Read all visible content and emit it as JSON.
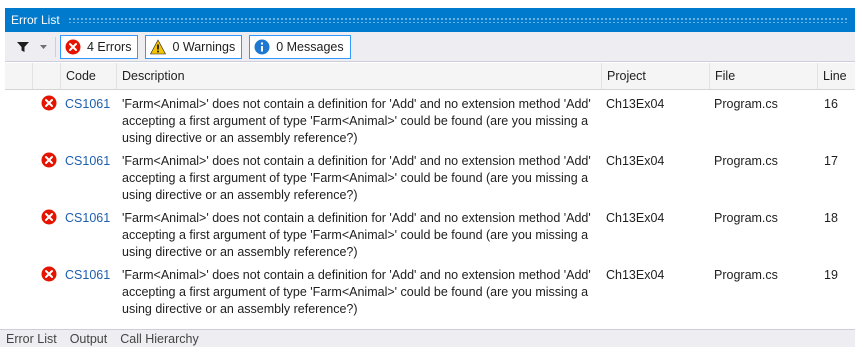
{
  "window": {
    "title": "Error List"
  },
  "toolbar": {
    "errors_label": "4 Errors",
    "warnings_label": "0 Warnings",
    "messages_label": "0 Messages"
  },
  "columns": {
    "code": "Code",
    "description": "Description",
    "project": "Project",
    "file": "File",
    "line": "Line"
  },
  "errors": [
    {
      "code": "CS1061",
      "description": "'Farm<Animal>' does not contain a definition for 'Add' and no extension method 'Add' accepting a first argument of type 'Farm<Animal>' could be found (are you missing a using directive or an assembly reference?)",
      "project": "Ch13Ex04",
      "file": "Program.cs",
      "line": "16"
    },
    {
      "code": "CS1061",
      "description": "'Farm<Animal>' does not contain a definition for 'Add' and no extension method 'Add' accepting a first argument of type 'Farm<Animal>' could be found (are you missing a using directive or an assembly reference?)",
      "project": "Ch13Ex04",
      "file": "Program.cs",
      "line": "17"
    },
    {
      "code": "CS1061",
      "description": "'Farm<Animal>' does not contain a definition for 'Add' and no extension method 'Add' accepting a first argument of type 'Farm<Animal>' could be found (are you missing a using directive or an assembly reference?)",
      "project": "Ch13Ex04",
      "file": "Program.cs",
      "line": "18"
    },
    {
      "code": "CS1061",
      "description": "'Farm<Animal>' does not contain a definition for 'Add' and no extension method 'Add' accepting a first argument of type 'Farm<Animal>' could be found (are you missing a using directive or an assembly reference?)",
      "project": "Ch13Ex04",
      "file": "Program.cs",
      "line": "19"
    }
  ],
  "bottom_tabs": [
    "Error List",
    "Output",
    "Call Hierarchy"
  ],
  "icons": {
    "filter": "filter-icon",
    "dropdown": "chevron-down-icon",
    "error": "error-icon",
    "warning": "warning-icon",
    "info": "info-icon"
  },
  "colors": {
    "titlebar": "#007acc",
    "error": "#e51400",
    "warning": "#f5c400",
    "info": "#1e78d2",
    "code_link": "#1e5fad"
  }
}
